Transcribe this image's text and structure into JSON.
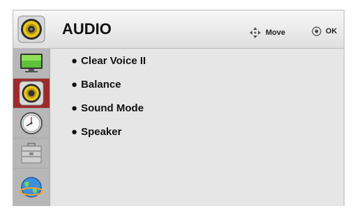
{
  "header": {
    "title": "AUDIO",
    "move_label": "Move",
    "ok_label": "OK"
  },
  "sidebar": {
    "items": [
      {
        "icon": "tv-screen-icon",
        "active": false
      },
      {
        "icon": "speaker-icon",
        "active": true
      },
      {
        "icon": "clock-icon",
        "active": false
      },
      {
        "icon": "toolbox-icon",
        "active": false
      },
      {
        "icon": "globe-network-icon",
        "active": false
      }
    ]
  },
  "menu": {
    "items": [
      {
        "label": "Clear Voice II"
      },
      {
        "label": "Balance"
      },
      {
        "label": "Sound Mode"
      },
      {
        "label": "Speaker"
      }
    ],
    "bullet": "●"
  },
  "colors": {
    "active_sidebar": "#9e2b2a",
    "speaker_cone": "#e8c61a"
  }
}
